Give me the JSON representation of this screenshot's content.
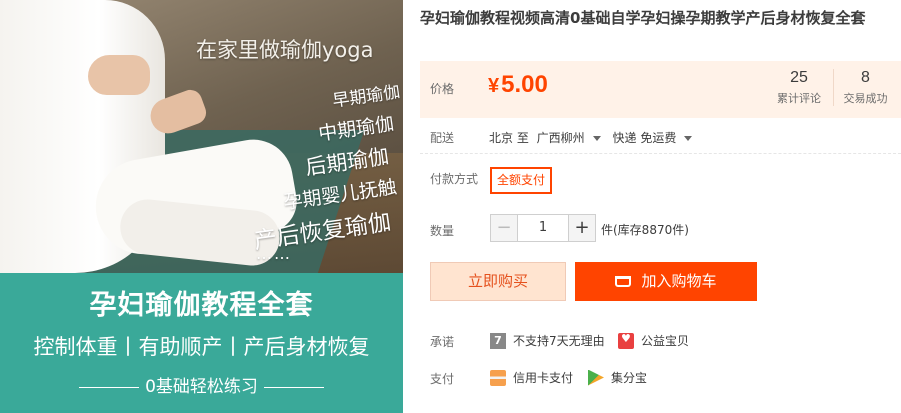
{
  "hero": {
    "overlay_top": "在家里做瑜伽yoga",
    "overlay_lines": [
      "早期瑜伽",
      "中期瑜伽",
      "后期瑜伽",
      "孕期婴儿抚触",
      "产后恢复瑜伽",
      "……"
    ],
    "banner_title": "孕妇瑜伽教程全套",
    "banner_subtitle": "控制体重丨有助顺产丨产后身材恢复",
    "banner_footer": "0基础轻松练习"
  },
  "product": {
    "title": "孕妇瑜伽教程视频高清0基础自学孕妇操孕期教学产后身材恢复全套"
  },
  "price": {
    "label": "价格",
    "currency": "¥",
    "value": "5.00",
    "reviews_count": "25",
    "reviews_label": "累计评论",
    "sales_count": "8",
    "sales_label": "交易成功"
  },
  "delivery": {
    "label": "配送",
    "from": "北京 至",
    "to": "广西柳州",
    "method": "快递 免运费"
  },
  "payment_method": {
    "label": "付款方式",
    "option": "全额支付"
  },
  "quantity": {
    "label": "数量",
    "minus": "−",
    "value": "1",
    "plus": "+",
    "stock_text": "件(库存8870件)"
  },
  "actions": {
    "buy_now": "立即购买",
    "add_to_cart": "加入购物车"
  },
  "promise": {
    "label": "承诺",
    "items": [
      {
        "icon": "seven-day-icon",
        "glyph": "7",
        "text": "不支持7天无理由"
      },
      {
        "icon": "charity-icon",
        "text": "公益宝贝"
      }
    ]
  },
  "pay": {
    "label": "支付",
    "items": [
      {
        "icon": "credit-card-icon",
        "text": "信用卡支付"
      },
      {
        "icon": "jifenbao-icon",
        "text": "集分宝"
      }
    ]
  },
  "colors": {
    "accent": "#ff4400",
    "price_bg": "#fff2e8",
    "banner_teal": "#3aa999"
  }
}
